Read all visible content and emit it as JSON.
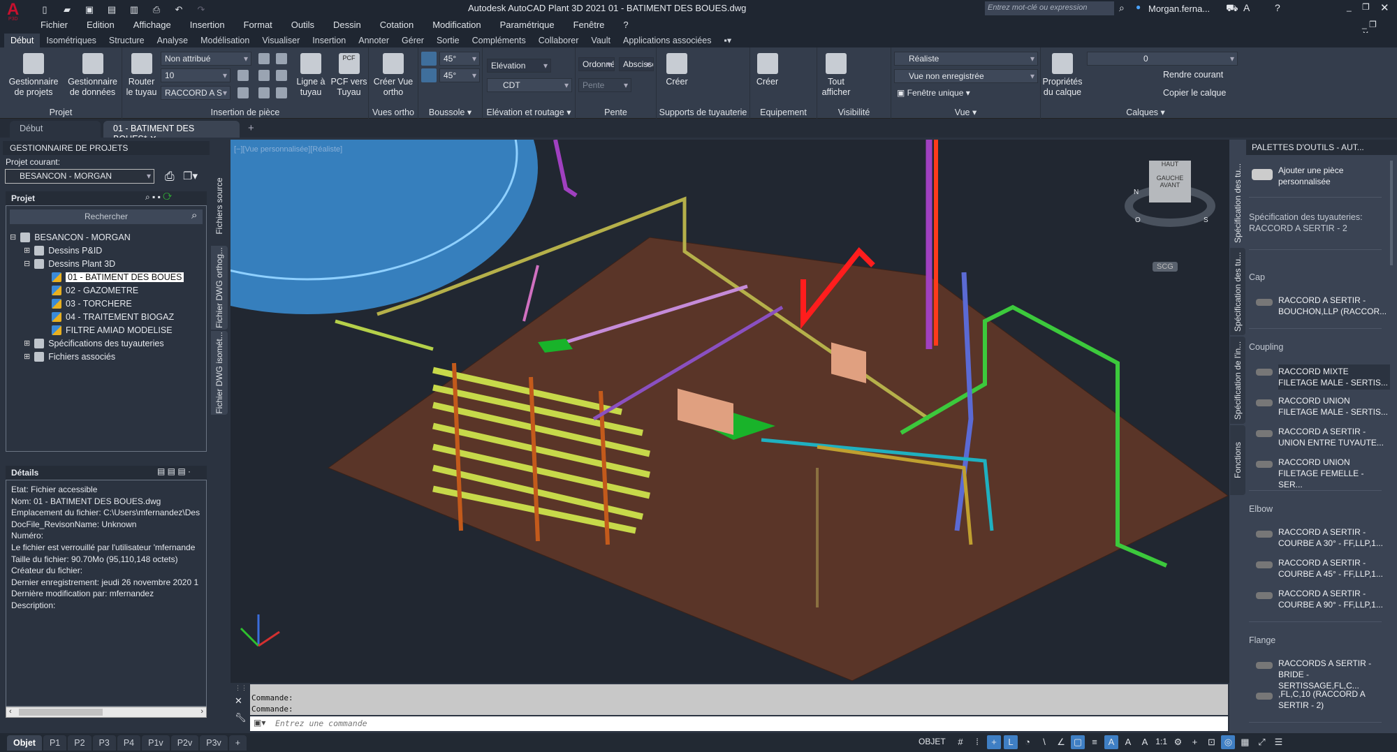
{
  "app": {
    "logo": "A",
    "logo_sub": "P3D",
    "title": "Autodesk AutoCAD Plant 3D 2021    01 - BATIMENT DES BOUES.dwg",
    "search_placeholder": "Entrez mot-clé ou expression",
    "user": "Morgan.ferna...",
    "accent": "#c8102e"
  },
  "menu": [
    "Fichier",
    "Edition",
    "Affichage",
    "Insertion",
    "Format",
    "Outils",
    "Dessin",
    "Cotation",
    "Modification",
    "Paramétrique",
    "Fenêtre",
    "?"
  ],
  "ribbon_tabs": [
    "Début",
    "Isométriques",
    "Structure",
    "Analyse",
    "Modélisation",
    "Visualiser",
    "Insertion",
    "Annoter",
    "Gérer",
    "Sortie",
    "Compléments",
    "Collaborer",
    "Vault",
    "Applications associées"
  ],
  "ribbon": {
    "projet": {
      "label": "Projet",
      "btn1": "Gestionnaire de projets",
      "btn2": "Gestionnaire de données"
    },
    "insertion": {
      "label": "Insertion de pièce",
      "router": "Router le tuyau",
      "combo1": "Non attribué",
      "combo2": "10",
      "combo3": "RACCORD A S",
      "ligne": "Ligne à tuyau",
      "pcf_icon": "PCF",
      "pcf": "PCF vers Tuyau"
    },
    "vues_ortho": {
      "label": "Vues ortho",
      "btn": "Créer Vue ortho"
    },
    "boussole": {
      "label": "Boussole",
      "angle1": "45°",
      "angle2": "45°"
    },
    "elevation": {
      "label": "Elévation et routage",
      "field": "Elévation",
      "combo": "CDT"
    },
    "pente": {
      "label": "Pente",
      "ordonnee": "Ordonné",
      "abscisse": "Abscisse",
      "pente": "Pente"
    },
    "supports": {
      "label": "Supports de tuyauterie",
      "btn": "Créer"
    },
    "equipement": {
      "label": "Equipement",
      "btn": "Créer"
    },
    "visibilite": {
      "label": "Visibilité",
      "btn": "Tout afficher"
    },
    "vue": {
      "label": "Vue",
      "style": "Réaliste",
      "view": "Vue non enregistrée",
      "window": "Fenêtre unique"
    },
    "calques": {
      "label": "Calques",
      "props": "Propriétés du calque",
      "layer": "0",
      "rendre": "Rendre courant",
      "copier": "Copier le calque"
    }
  },
  "doc_tabs": [
    {
      "label": "Début"
    },
    {
      "label": "01 - BATIMENT DES BOUES*"
    }
  ],
  "left_palette": {
    "title": "GESTIONNAIRE DE PROJETS",
    "current_label": "Projet courant:",
    "current_value": "BESANCON - MORGAN",
    "project_header": "Projet",
    "search_placeholder": "Rechercher",
    "tree": [
      {
        "label": "BESANCON - MORGAN",
        "level": 0,
        "toggle": "−"
      },
      {
        "label": "Dessins P&ID",
        "level": 1,
        "toggle": "+"
      },
      {
        "label": "Dessins Plant 3D",
        "level": 1,
        "toggle": "−"
      },
      {
        "label": "01 - BATIMENT DES BOUES",
        "level": 2,
        "selected": true
      },
      {
        "label": "02 - GAZOMETRE",
        "level": 2
      },
      {
        "label": "03 - TORCHERE",
        "level": 2
      },
      {
        "label": "04 - TRAITEMENT BIOGAZ",
        "level": 2
      },
      {
        "label": "FILTRE AMIAD MODELISE",
        "level": 2
      },
      {
        "label": "Spécifications des tuyauteries",
        "level": 1,
        "toggle": "+"
      },
      {
        "label": "Fichiers associés",
        "level": 1,
        "toggle": "+"
      }
    ],
    "details_header": "Détails",
    "details": [
      "Etat: Fichier accessible",
      "Nom: 01 - BATIMENT DES BOUES.dwg",
      "Emplacement du fichier: C:\\Users\\mfernandez\\Des",
      "DocFile_RevisonName:  Unknown",
      "Numéro:",
      "Le fichier est verrouillé par l'utilisateur 'mfernande",
      "Taille du fichier: 90.70Mo (95,110,148 octets)",
      "Créateur du fichier:",
      "Dernier enregistrement: jeudi 26 novembre 2020 1",
      "Dernière modification par: mfernandez",
      "Description:"
    ],
    "side_tabs": [
      "Fichiers source",
      "Fichier DWG orthog...",
      "Fichier DWG isomét..."
    ]
  },
  "viewport": {
    "label": "[−][Vue personnalisée][Réaliste]",
    "viewcube": {
      "top": "HAUT",
      "left": "GAUCHE",
      "front": "AVANT",
      "n": "N",
      "o": "O",
      "s": "S",
      "ucs": "SCG"
    }
  },
  "command": {
    "history": [
      "Commande:",
      "Commande:"
    ],
    "placeholder": "Entrez une commande"
  },
  "status": {
    "layout_tabs": [
      "Objet",
      "P1",
      "P2",
      "P3",
      "P4",
      "P1v",
      "P2v",
      "P3v"
    ],
    "mode": "OBJET",
    "scale": "1:1"
  },
  "right_palette": {
    "title": "PALETTES D'OUTILS - AUT...",
    "side_tabs": [
      "Spécification des tu...",
      "Spécification des tu...",
      "Spécification de l'in...",
      "Fonctions"
    ],
    "add_custom": "Ajouter une pièce personnalisée",
    "spec": "Spécification des tuyauteries: RACCORD A SERTIR - 2",
    "sections": [
      {
        "name": "Cap",
        "items": [
          "RACCORD A SERTIR - BOUCHON,LLP  (RACCOR..."
        ]
      },
      {
        "name": "Coupling",
        "items": [
          "RACCORD MIXTE FILETAGE  MALE  -  SERTIS...",
          "RACCORD UNION FILETAGE  MALE  -  SERTIS...",
          "RACCORD A SERTIR - UNION  ENTRE  TUYAUTE...",
          "RACCORD UNION FILETAGE  FEMELLE  -  SER..."
        ]
      },
      {
        "name": "Elbow",
        "items": [
          "RACCORD A SERTIR - COURBE A 30° - FF,LLP,1...",
          "RACCORD A SERTIR - COURBE A 45° - FF,LLP,1...",
          "RACCORD A SERTIR - COURBE A 90° - FF,LLP,1..."
        ]
      },
      {
        "name": "Flange",
        "items": [
          "RACCORDS A SERTIR - BRIDE  -  SERTISSAGE,FL,C...",
          ",FL,C,10 (RACCORD A SERTIR - 2)"
        ]
      }
    ]
  }
}
